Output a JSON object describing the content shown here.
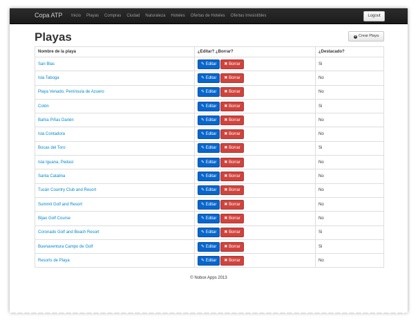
{
  "nav": {
    "brand": "Copa ATP",
    "items": [
      "Inicio",
      "Playas",
      "Compras",
      "Ciudad",
      "Naturaleza",
      "Hoteles",
      "Ofertas de Hoteles",
      "Ofertas Irresistibles"
    ],
    "logout": "Logout"
  },
  "page": {
    "title": "Playas",
    "create_label": "Crear Playa",
    "create_icon": "+"
  },
  "table": {
    "headers": [
      "Nombre de la playa",
      "¿Editar? ¿Borrar?",
      "¿Destacado?"
    ],
    "edit_label": "Editar",
    "edit_icon": "✎",
    "delete_label": "Borrar",
    "delete_icon": "✖",
    "rows": [
      {
        "name": "San Blas",
        "featured": "Si"
      },
      {
        "name": "Isla Taboga",
        "featured": "No"
      },
      {
        "name": "Playa Venado, Península de Azuero",
        "featured": "No"
      },
      {
        "name": "Colón",
        "featured": "Si"
      },
      {
        "name": "Bahía Piñas Darién",
        "featured": "No"
      },
      {
        "name": "Isla Contadora",
        "featured": "No"
      },
      {
        "name": "Bocas del Toro",
        "featured": "Si"
      },
      {
        "name": "Isla Iguana, Pedasí",
        "featured": "No"
      },
      {
        "name": "Santa Catalina",
        "featured": "No"
      },
      {
        "name": "Tucán Country Club and Resort",
        "featured": "No"
      },
      {
        "name": "Summit Golf and Resort",
        "featured": "No"
      },
      {
        "name": "Bijao Golf Course",
        "featured": "No"
      },
      {
        "name": "Coronado Golf and Beach Resort",
        "featured": "Si"
      },
      {
        "name": "Buenaventura Campo de Golf",
        "featured": "Si"
      },
      {
        "name": "Resorts de Playa",
        "featured": "No"
      }
    ]
  },
  "footer": "© Nobox Apps 2013",
  "colors": {
    "navbar": "#1b1b1b",
    "link": "#0088cc",
    "edit": "#0866cc",
    "delete": "#d0433d"
  }
}
